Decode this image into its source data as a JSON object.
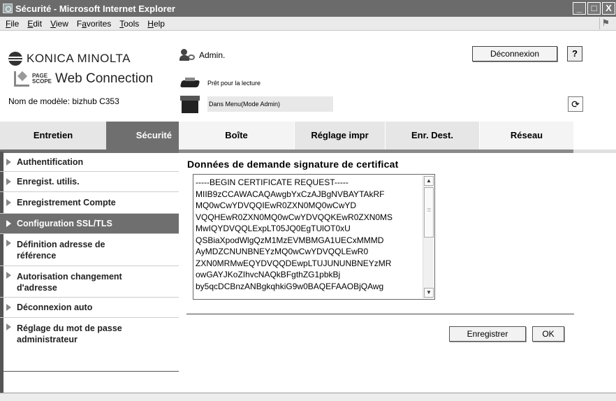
{
  "window": {
    "title": "Sécurité - Microsoft Internet Explorer",
    "buttons": {
      "minimize": "_",
      "maximize": "□",
      "close": "X"
    }
  },
  "menubar": {
    "items": [
      "File",
      "Edit",
      "View",
      "Favorites",
      "Tools",
      "Help"
    ],
    "underline": [
      "F",
      "E",
      "V",
      "a",
      "T",
      "H"
    ]
  },
  "header": {
    "brand": "KONICA MINOLTA",
    "pagescope_small_top": "PAGE",
    "pagescope_small_bottom": "SCOPE",
    "pagescope_product": "Web Connection",
    "model_label": "Nom de modèle: bizhub C353",
    "user": "Admin.",
    "logout_label": "Déconnexion",
    "help_label": "?",
    "status_printer": "Prêt pour la lecture",
    "status_scanner": "Dans Menu(Mode Admin)",
    "refresh_label": "⟳"
  },
  "tabs": [
    "Entretien",
    "Sécurité",
    "Boîte",
    "Réglage impr",
    "Enr. Dest.",
    "Réseau"
  ],
  "active_tab": "Sécurité",
  "sidebar": {
    "items": [
      {
        "line1": "Authentification",
        "line2": ""
      },
      {
        "line1": "Enregist. utilis.",
        "line2": ""
      },
      {
        "line1": "Enregistrement Compte",
        "line2": ""
      },
      {
        "line1": "Configuration SSL/TLS",
        "line2": ""
      },
      {
        "line1": "Définition adresse de",
        "line2": "référence"
      },
      {
        "line1": "Autorisation changement",
        "line2": "d'adresse"
      },
      {
        "line1": "Déconnexion auto",
        "line2": ""
      },
      {
        "line1": "Réglage du mot de passe",
        "line2": "administrateur"
      }
    ],
    "active_item": "Configuration SSL/TLS"
  },
  "main": {
    "title": "Données de demande signature de certificat",
    "certificate_lines": [
      "-----BEGIN CERTIFICATE REQUEST-----",
      "MIIB9zCCAWACAQAwgbYxCzAJBgNVBAYTAkRF",
      "MQ0wCwYDVQQIEwR0ZXN0MQ0wCwYD",
      "VQQHEwR0ZXN0MQ0wCwYDVQQKEwR0ZXN0MS",
      "MwIQYDVQQLExpLT05JQ0EgTUlOT0xU",
      "QSBiaXpodWlgQzM1MzEVMBMGA1UECxMMMD",
      "AyMDZCNUNBNEYzMQ0wCwYDVQQLEwR0",
      "ZXN0MRMwEQYDVQQDEwpLTUJUNUNBNEYzMR",
      "owGAYJKoZIhvcNAQkBFgthZG1pbkBj",
      "by5qcDCBnzANBgkqhkiG9w0BAQEFAAOBjQAwg"
    ],
    "save_label": "Enregistrer",
    "ok_label": "OK"
  }
}
